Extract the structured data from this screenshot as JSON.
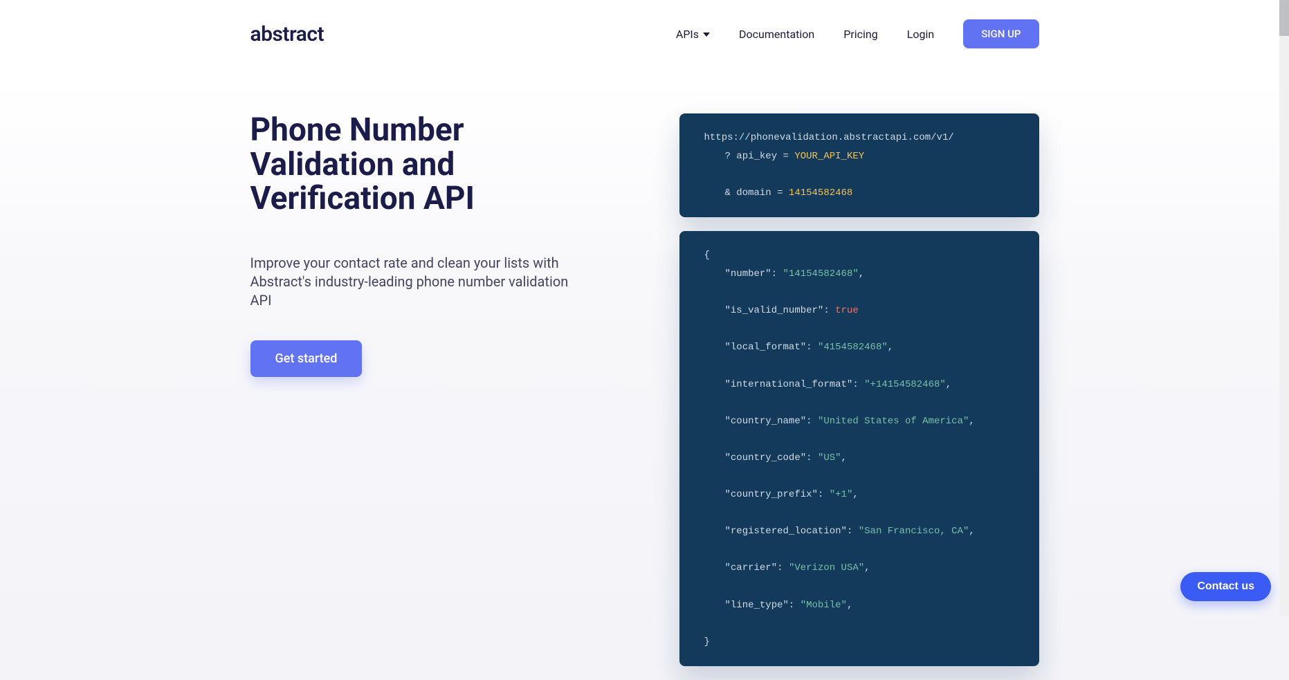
{
  "nav": {
    "logo": "abstract",
    "links": {
      "apis": "APIs",
      "documentation": "Documentation",
      "pricing": "Pricing",
      "login": "Login"
    },
    "signup": "SIGN UP"
  },
  "hero": {
    "title": "Phone Number Validation and Verification API",
    "subtitle": "Improve your contact rate and clean your lists with Abstract's industry-leading phone number validation API",
    "cta": "Get started"
  },
  "request_block": {
    "url": "https://phonevalidation.abstractapi.com/v1/",
    "param1_prefix": "? api_key = ",
    "param1_value": "YOUR_API_KEY",
    "param2_prefix": "& domain = ",
    "param2_value": "14154582468"
  },
  "response_block": {
    "open": "{",
    "close": "}",
    "rows": [
      {
        "key": "\"number\"",
        "sep": ": ",
        "val": "\"14154582468\"",
        "type": "str",
        "trail": ","
      },
      {
        "key": "\"is_valid_number\"",
        "sep": ": ",
        "val": "true",
        "type": "bool",
        "trail": ""
      },
      {
        "key": "\"local_format\"",
        "sep": ": ",
        "val": "\"4154582468\"",
        "type": "str",
        "trail": ","
      },
      {
        "key": "\"international_format\"",
        "sep": ": ",
        "val": "\"+14154582468\"",
        "type": "str",
        "trail": ","
      },
      {
        "key": "\"country_name\"",
        "sep": ": ",
        "val": "\"United States of America\"",
        "type": "str",
        "trail": ","
      },
      {
        "key": "\"country_code\"",
        "sep": ": ",
        "val": "\"US\"",
        "type": "str",
        "trail": ","
      },
      {
        "key": "\"country_prefix\"",
        "sep": ": ",
        "val": "\"+1\"",
        "type": "str",
        "trail": ","
      },
      {
        "key": "\"registered_location\"",
        "sep": ": ",
        "val": "\"San Francisco, CA\"",
        "type": "str",
        "trail": ","
      },
      {
        "key": "\"carrier\"",
        "sep": ": ",
        "val": "\"Verizon USA\"",
        "type": "str",
        "trail": ","
      },
      {
        "key": "\"line_type\"",
        "sep": ": ",
        "val": "\"Mobile\"",
        "type": "str",
        "trail": ","
      }
    ]
  },
  "contact": "Contact us"
}
